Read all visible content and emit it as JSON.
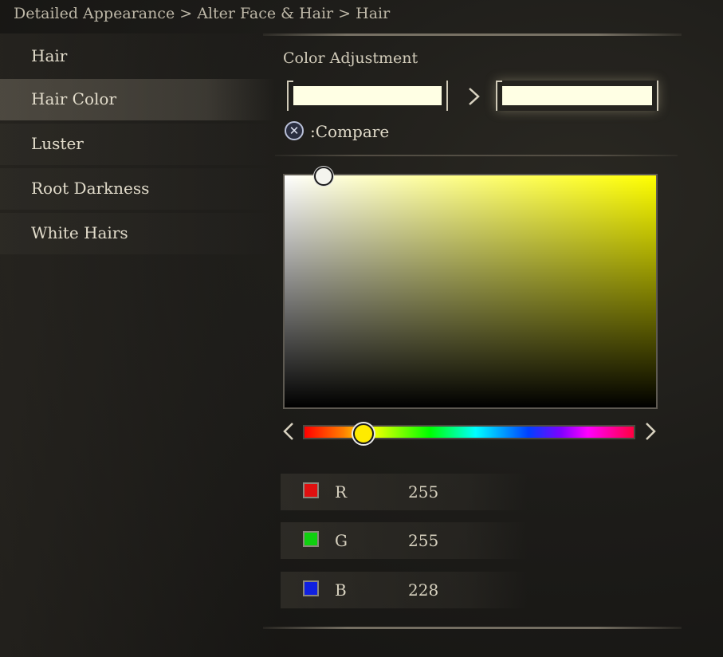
{
  "breadcrumb": "Detailed Appearance > Alter Face & Hair > Hair",
  "sidebar": {
    "items": [
      {
        "label": "Hair"
      },
      {
        "label": "Hair Color"
      },
      {
        "label": "Luster"
      },
      {
        "label": "Root Darkness"
      },
      {
        "label": "White Hairs"
      }
    ],
    "active_index": 1
  },
  "color_adjustment": {
    "title": "Color Adjustment",
    "previous_color": "#ffffe4",
    "new_color": "#ffffe4",
    "compare_button_glyph": "✕",
    "compare_label": ":Compare"
  },
  "picker": {
    "hue_color": "#ffff00",
    "saturation": 0.1,
    "brightness": 1.0
  },
  "hue_slider": {
    "value": 0.18
  },
  "rgb": {
    "r": {
      "label": "R",
      "value": "255",
      "chip_color": "#e01010"
    },
    "g": {
      "label": "G",
      "value": "255",
      "chip_color": "#10d010"
    },
    "b": {
      "label": "B",
      "value": "228",
      "chip_color": "#1020e0"
    }
  }
}
